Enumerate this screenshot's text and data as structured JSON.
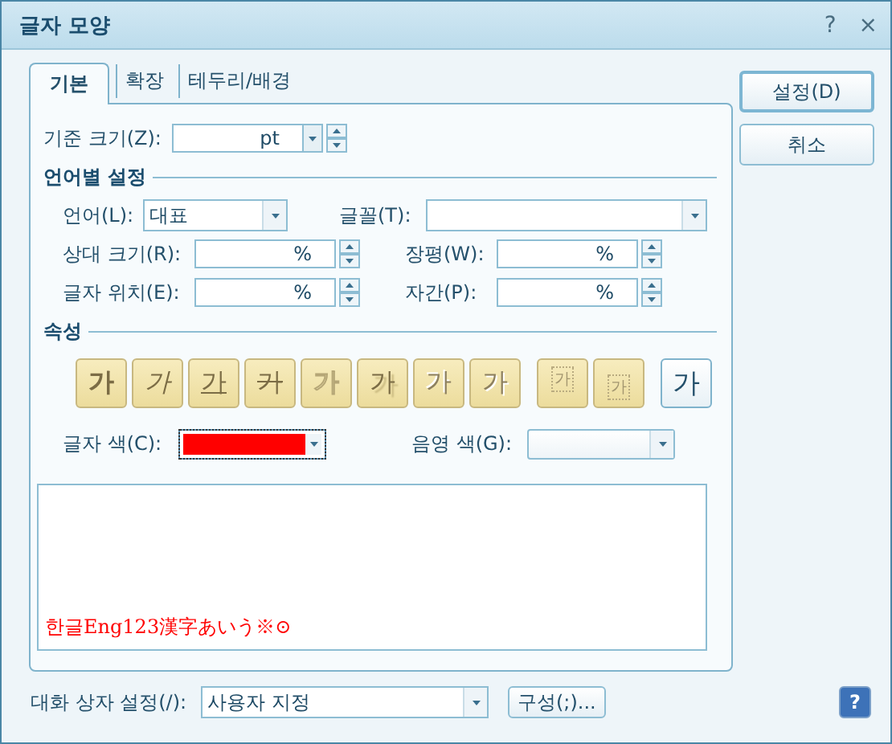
{
  "window": {
    "title": "글자 모양",
    "help": "?",
    "close": "×"
  },
  "tabs": [
    {
      "label": "기본",
      "selected": true
    },
    {
      "label": "확장",
      "selected": false
    },
    {
      "label": "테두리/배경",
      "selected": false
    }
  ],
  "base_size": {
    "label": "기준 크기(Z):",
    "unit": "pt"
  },
  "language_section": {
    "heading": "언어별 설정",
    "language": {
      "label": "언어(L):",
      "value": "대표"
    },
    "font": {
      "label": "글꼴(T):"
    },
    "fields": [
      {
        "label": "상대 크기(R):",
        "unit": "%"
      },
      {
        "label": "장평(W):",
        "unit": "%"
      },
      {
        "label": "글자 위치(E):",
        "unit": "%"
      },
      {
        "label": "자간(P):",
        "unit": "%"
      }
    ]
  },
  "attributes": {
    "heading": "속성",
    "buttons": [
      {
        "kind": "bold",
        "glyph": "가"
      },
      {
        "kind": "italic",
        "glyph": "가"
      },
      {
        "kind": "underline",
        "glyph": "가"
      },
      {
        "kind": "strike",
        "glyph": "가"
      },
      {
        "kind": "outline",
        "glyph": "가"
      },
      {
        "kind": "shadow",
        "glyph": "가"
      },
      {
        "kind": "emboss",
        "glyph": "가"
      },
      {
        "kind": "engrave",
        "glyph": "가"
      },
      {
        "kind": "superscript",
        "glyph": "가"
      },
      {
        "kind": "subscript",
        "glyph": "가"
      },
      {
        "kind": "normal",
        "glyph": "가"
      }
    ]
  },
  "text_color": {
    "label": "글자 색(C):",
    "color": "#ff0000"
  },
  "shade_color": {
    "label": "음영 색(G):"
  },
  "preview": {
    "text": "한글Eng123漢字あいう※⊙"
  },
  "dialog_setting": {
    "label": "대화 상자 설정(/):",
    "value": "사용자 지정"
  },
  "configure_button": "구성(;)...",
  "help_button": "?",
  "buttons": [
    "설정(D)",
    "취소"
  ]
}
